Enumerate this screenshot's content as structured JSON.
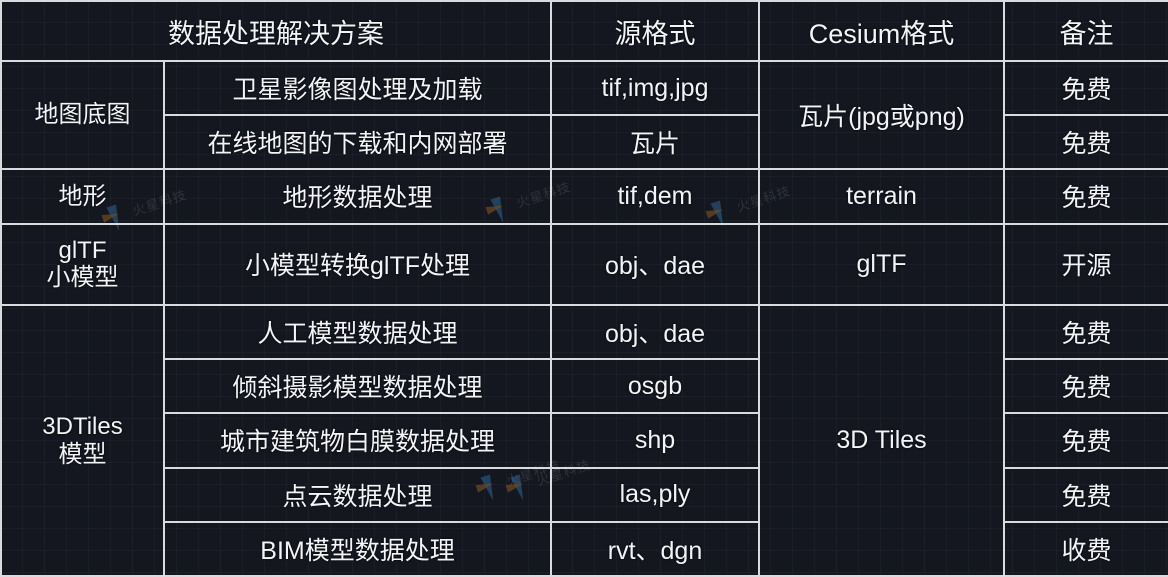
{
  "table": {
    "headers": [
      {
        "label": "数据处理解决方案",
        "name": "header-solution"
      },
      {
        "label": "源格式",
        "name": "header-source-format"
      },
      {
        "label": "Cesium格式",
        "name": "header-cesium-format"
      },
      {
        "label": "备注",
        "name": "header-remark"
      }
    ],
    "categories": [
      {
        "label": "地图底图"
      },
      {
        "label": "地形"
      },
      {
        "label": "glTF\n小模型",
        "line1": "glTF",
        "line2": "小模型"
      },
      {
        "label": "3DTiles\n模型",
        "line1": "3DTiles",
        "line2": "模型"
      }
    ],
    "rows": [
      {
        "solution": "卫星影像图处理及加载",
        "source": "tif,img,jpg",
        "cesium": "瓦片(jpg或png)",
        "remark": "免费"
      },
      {
        "solution": "在线地图的下载和内网部署",
        "source": "瓦片",
        "cesium": "",
        "remark": "免费"
      },
      {
        "solution": "地形数据处理",
        "source": "tif,dem",
        "cesium": "terrain",
        "remark": "免费"
      },
      {
        "solution": "小模型转换glTF处理",
        "source": "obj、dae",
        "cesium": "glTF",
        "remark": "开源"
      },
      {
        "solution": "人工模型数据处理",
        "source": "obj、dae",
        "cesium": "3D Tiles",
        "remark": "免费"
      },
      {
        "solution": "倾斜摄影模型数据处理",
        "source": "osgb",
        "cesium": "",
        "remark": "免费"
      },
      {
        "solution": "城市建筑物白膜数据处理",
        "source": "shp",
        "cesium": "",
        "remark": "免费"
      },
      {
        "solution": "点云数据处理",
        "source": "las,ply",
        "cesium": "",
        "remark": "免费"
      },
      {
        "solution": "BIM模型数据处理",
        "source": "rvt、dgn",
        "cesium": "",
        "remark": "收费"
      }
    ]
  },
  "watermark": {
    "text": "火星科技"
  },
  "colors": {
    "header_background": "#1d3a61",
    "page_background": "#14171f",
    "border": "#d9dbdf",
    "text": "#f2f4f7",
    "paid_highlight": "#f4f400"
  }
}
